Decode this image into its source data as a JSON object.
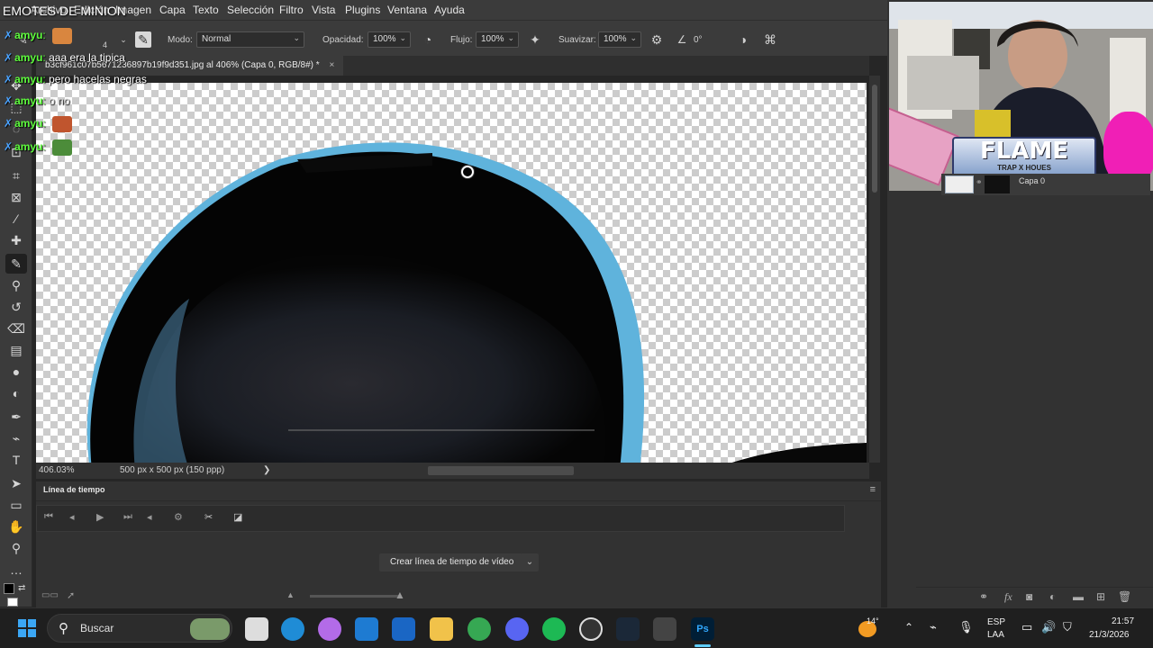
{
  "stream_overlay": {
    "title": "EMOTES DE MINION",
    "chat": [
      {
        "user": "amyu",
        "message": "",
        "emote": "face-emote"
      },
      {
        "user": "amyu",
        "message": "aaa era la tipica",
        "emote": ""
      },
      {
        "user": "amyu",
        "message": "pero hacelas negras",
        "emote": ""
      },
      {
        "user": "amyu",
        "message": "o no",
        "emote": ""
      },
      {
        "user": "amyu",
        "message": "",
        "emote": "face-emote"
      },
      {
        "user": "amyu",
        "message": "",
        "emote": "pepe-emote"
      }
    ],
    "banner": {
      "title": "FLAME",
      "subtitle": "TRAP X HOUES"
    }
  },
  "menu": [
    "Archivo",
    "Edición",
    "Imagen",
    "Capa",
    "Texto",
    "Selección",
    "Filtro",
    "Vista",
    "Plugins",
    "Ventana",
    "Ayuda"
  ],
  "options": {
    "brush_size": "4",
    "mode_label": "Modo:",
    "mode_value": "Normal",
    "opacity_label": "Opacidad:",
    "opacity_value": "100%",
    "flow_label": "Flujo:",
    "flow_value": "100%",
    "smooth_label": "Suavizar:",
    "smooth_value": "100%",
    "angle_value": "0°"
  },
  "document_tab": {
    "title": "b3cf961c07b5671236897b19f9d351.jpg al 406% (Capa 0, RGB/8#) *",
    "close": "×"
  },
  "status": {
    "zoom": "406.03%",
    "doc_info": "500 px x 500 px (150 ppp)",
    "arrow": "❯"
  },
  "timeline": {
    "title": "Línea de tiempo",
    "create_button": "Crear línea de tiempo de vídeo"
  },
  "layers": {
    "layer_name": "Capa 0"
  },
  "taskbar": {
    "search_placeholder": "Buscar",
    "weather_temp": "14°",
    "language_top": "ESP",
    "language_bottom": "LAA",
    "time": "21:57",
    "date": "21/3/2026"
  }
}
